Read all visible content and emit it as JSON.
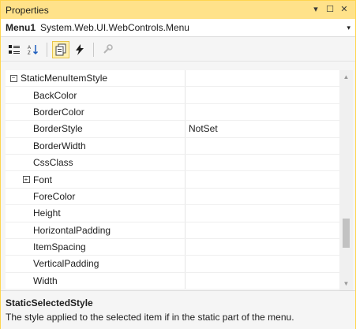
{
  "window": {
    "title": "Properties"
  },
  "titlebar_icons": {
    "menu": "dropdown-arrow-icon",
    "maximize": "maximize-icon",
    "close": "close-icon"
  },
  "object_selector": {
    "name": "Menu1",
    "type": "System.Web.UI.WebControls.Menu"
  },
  "toolbar": {
    "buttons": [
      "categorized-icon",
      "alphabetical-icon",
      "properties-icon",
      "events-icon",
      "property-pages-icon"
    ]
  },
  "grid": {
    "rows": [
      {
        "name": "StaticMenuItemStyle",
        "value": "",
        "expander": "−"
      },
      {
        "name": "BackColor",
        "value": ""
      },
      {
        "name": "BorderColor",
        "value": ""
      },
      {
        "name": "BorderStyle",
        "value": "NotSet"
      },
      {
        "name": "BorderWidth",
        "value": ""
      },
      {
        "name": "CssClass",
        "value": ""
      },
      {
        "name": "Font",
        "value": "",
        "expander": "+"
      },
      {
        "name": "ForeColor",
        "value": ""
      },
      {
        "name": "Height",
        "value": ""
      },
      {
        "name": "HorizontalPadding",
        "value": ""
      },
      {
        "name": "ItemSpacing",
        "value": ""
      },
      {
        "name": "VerticalPadding",
        "value": ""
      },
      {
        "name": "Width",
        "value": ""
      }
    ]
  },
  "scrollbar": {
    "position": 0.82,
    "visible_fraction": 0.15
  },
  "description": {
    "title": "StaticSelectedStyle",
    "text": "The style applied to the selected item if in the static part of the menu."
  },
  "colors": {
    "titlebar": "#ffe28a",
    "accent": "#ffd54f",
    "active_button": "#fff0b3"
  }
}
